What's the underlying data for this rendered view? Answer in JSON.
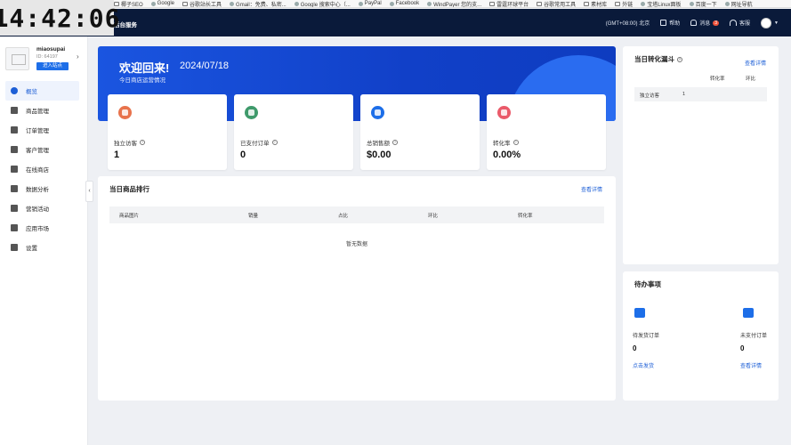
{
  "clock": "14:42:06",
  "bookmarks": [
    "服务器信息",
    "百度一下，你就知道",
    "椰子SEO",
    "Google",
    "谷歌站长工具",
    "Gmail：免费、私密...",
    "Google 搜索中心（...",
    "PayPal",
    "Facebook",
    "WindPayer 您的支...",
    "雷霆环球平台",
    "谷歌常用工具",
    "素材库",
    "外链",
    "宝塔Linux面板",
    "百度一下",
    "网址导航"
  ],
  "topbar": {
    "brand": "后台服务",
    "timezone": "(GMT+08:00) 北京",
    "help": "帮助",
    "messages": "消息",
    "message_count": "3",
    "service": "客服"
  },
  "shop": {
    "name": "miaosupai",
    "id": "ID: 64197",
    "enter_button": "进入站点"
  },
  "nav": [
    "概览",
    "商品管理",
    "订单管理",
    "客户管理",
    "在线商店",
    "数据分析",
    "营销活动",
    "应用市场",
    "设置"
  ],
  "hero": {
    "title": "欢迎回来!",
    "date": "2024/07/18",
    "subtitle": "今日商店运营情况"
  },
  "stats": [
    {
      "label": "独立访客",
      "value": "1",
      "color": "#e8734c"
    },
    {
      "label": "已支付订单",
      "value": "0",
      "color": "#3f9a6b"
    },
    {
      "label": "总销售额",
      "value": "$0.00",
      "color": "#1d6ee8"
    },
    {
      "label": "转化率",
      "value": "0.00%",
      "color": "#ea5a6a"
    }
  ],
  "ranking": {
    "title": "当日商品排行",
    "view_details": "查看详情",
    "columns": [
      "商品图片",
      "销量",
      "占比",
      "环比",
      "转化率"
    ],
    "empty": "暂无数据"
  },
  "funnel": {
    "title": "当日转化漏斗",
    "view_details": "查看详情",
    "columns": [
      "转化率",
      "环比"
    ],
    "row_label": "独立访客",
    "row_value": "1"
  },
  "todo": {
    "title": "待办事项",
    "items": [
      {
        "label": "待发货订单",
        "value": "0",
        "action": "点击发货"
      },
      {
        "label": "未支付订单",
        "value": "0",
        "action": "查看详情"
      }
    ]
  }
}
